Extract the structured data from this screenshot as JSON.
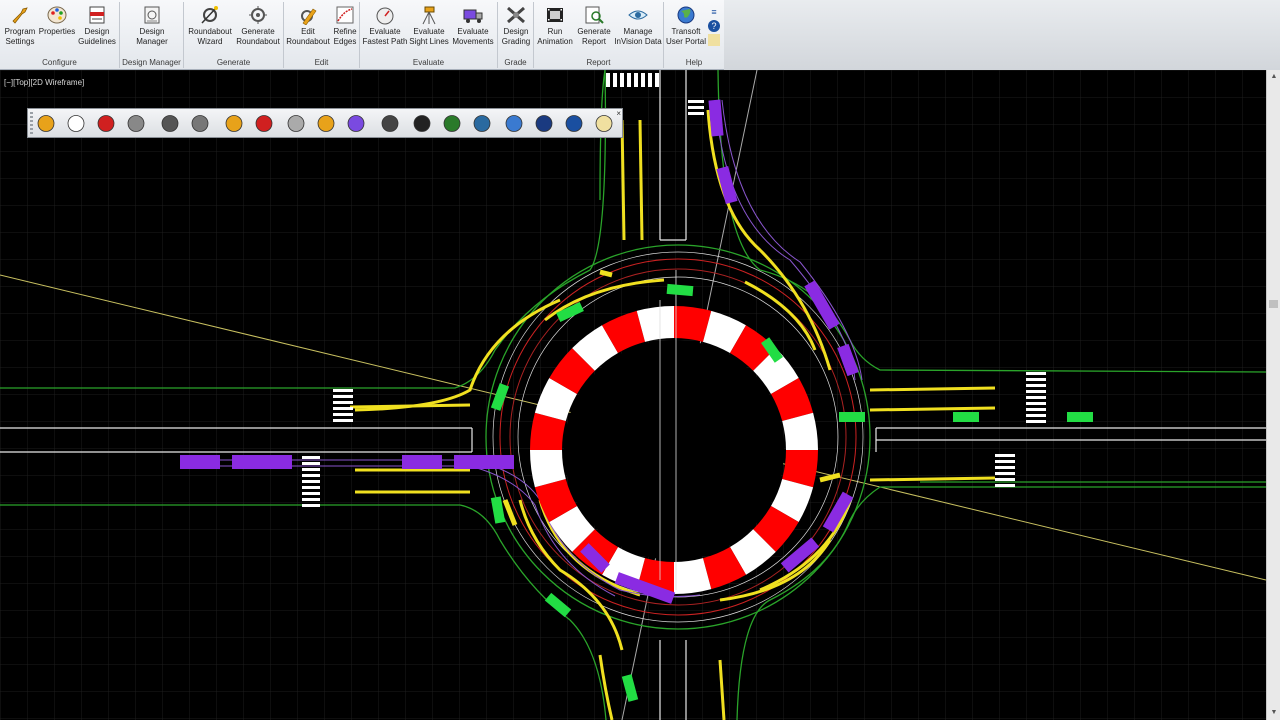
{
  "ribbon": {
    "groups": [
      {
        "label": "Configure",
        "buttons": [
          {
            "label": "Program\nSettings",
            "icon": "wrench-icon"
          },
          {
            "label": "Properties",
            "icon": "palette-icon"
          },
          {
            "label": "Design\nGuidelines",
            "icon": "guidelines-icon"
          }
        ]
      },
      {
        "label": "Design Manager",
        "buttons": [
          {
            "label": "Design\nManager",
            "icon": "design-manager-icon"
          }
        ]
      },
      {
        "label": "Generate",
        "buttons": [
          {
            "label": "Roundabout\nWizard",
            "icon": "roundabout-wizard-icon"
          },
          {
            "label": "Generate\nRoundabout",
            "icon": "generate-roundabout-icon"
          }
        ]
      },
      {
        "label": "Edit",
        "buttons": [
          {
            "label": "Edit\nRoundabout",
            "icon": "edit-roundabout-icon"
          },
          {
            "label": "Refine\nEdges",
            "icon": "refine-edges-icon"
          }
        ]
      },
      {
        "label": "Evaluate",
        "buttons": [
          {
            "label": "Evaluate\nFastest Path",
            "icon": "speedometer-icon"
          },
          {
            "label": "Evaluate\nSight Lines",
            "icon": "tripod-icon"
          },
          {
            "label": "Evaluate\nMovements",
            "icon": "truck-icon"
          }
        ]
      },
      {
        "label": "Grade",
        "buttons": [
          {
            "label": "Design\nGrading",
            "icon": "grading-icon"
          }
        ]
      },
      {
        "label": "Report",
        "buttons": [
          {
            "label": "Run\nAnimation",
            "icon": "film-icon"
          },
          {
            "label": "Generate\nReport",
            "icon": "report-icon"
          },
          {
            "label": "Manage\nInVision Data",
            "icon": "eye-icon"
          }
        ]
      },
      {
        "label": "Help",
        "buttons": [
          {
            "label": "Transoft\nUser Portal",
            "icon": "globe-icon"
          }
        ]
      }
    ]
  },
  "viewport": {
    "label": "[−][Top][2D Wireframe]"
  },
  "floating_toolbar": {
    "icons": [
      "wrench-icon",
      "palette-icon",
      "guidelines-icon",
      "design-manager-icon",
      "roundabout-wizard-icon",
      "generate-roundabout-icon",
      "edit-roundabout-icon",
      "refine-edges-icon",
      "speedometer-icon",
      "tripod-icon",
      "truck-icon",
      "grading-icon",
      "film-icon",
      "report-icon",
      "eye-icon",
      "globe-icon",
      "graduation-cap-icon",
      "help-icon",
      "notepad-icon"
    ]
  },
  "colors": {
    "background": "#000000",
    "curb": "#22aa22",
    "marking": "#f0e020",
    "vehicle": "#8a2be2",
    "apron_red": "#ff0000",
    "grid": "#1c1c1c"
  }
}
